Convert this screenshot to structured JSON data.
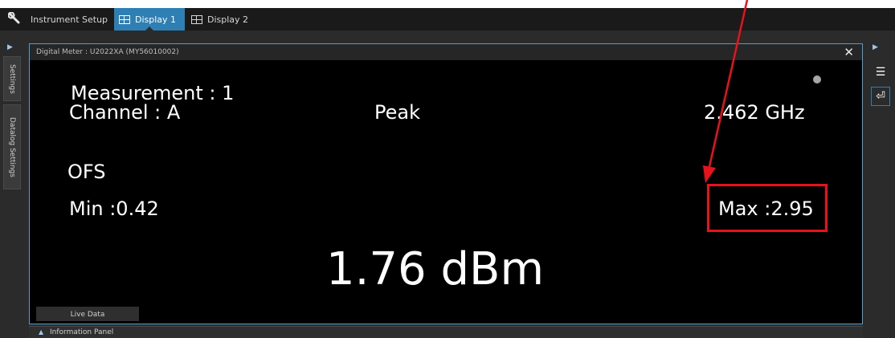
{
  "topbar": {
    "tabs": [
      {
        "label": "Instrument Setup",
        "icon": "wrench-icon",
        "active": false
      },
      {
        "label": "Display 1",
        "icon": "grid-layout-icon",
        "active": true
      },
      {
        "label": "Display 2",
        "icon": "grid-layout-icon",
        "active": false
      }
    ]
  },
  "left_panel": {
    "tabs": [
      "Settings",
      "Datalog Settings"
    ]
  },
  "right_panel": {
    "buttons": [
      {
        "icon": "list-icon",
        "glyph": "☰"
      },
      {
        "icon": "return-icon",
        "glyph": "⏎"
      }
    ]
  },
  "meter": {
    "title": "Digital Meter : U2022XA (MY56010002)",
    "measurement": "Measurement : 1",
    "channel": "Channel : A",
    "mode": "Peak",
    "frequency": "2.462 GHz",
    "offset_label": "OFS",
    "min": "Min :0.42",
    "max": "Max :2.95",
    "reading": "1.76 dBm",
    "live_tab": "Live Data"
  },
  "info_panel": {
    "label": "Information Panel"
  },
  "annotation": {
    "color": "#e8121b"
  }
}
